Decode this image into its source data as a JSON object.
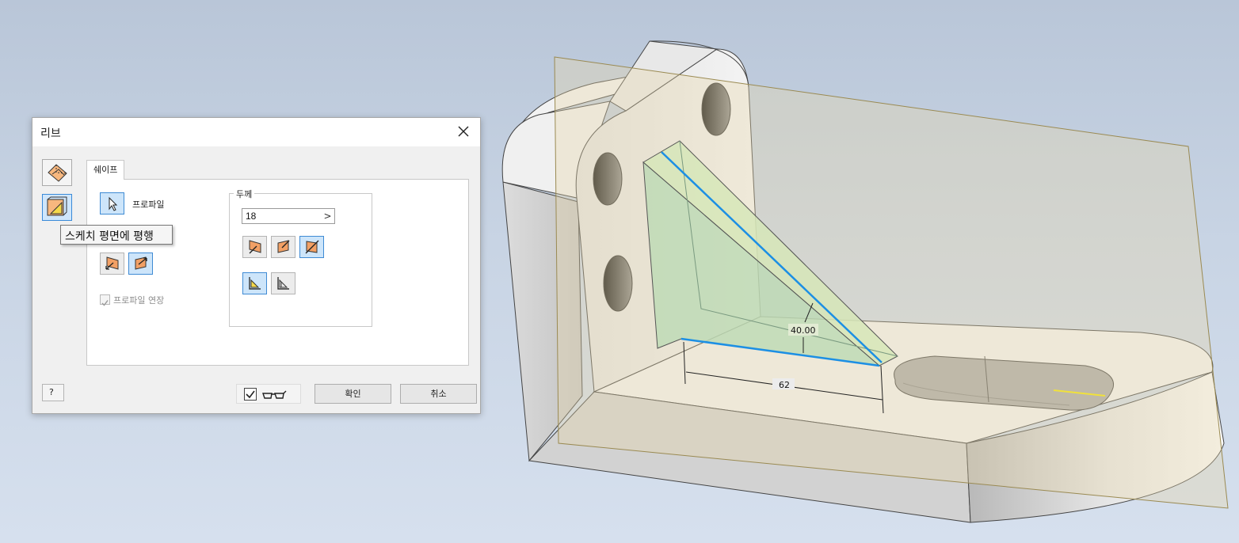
{
  "dialog": {
    "title": "리브",
    "tab_label": "쉐이프",
    "profile_label": "프로파일",
    "extend_profile_label": "프로파일 연장",
    "thickness_group_label": "두께",
    "thickness_value": "18",
    "spin_glyph": ">",
    "tooltip": "스케치 평면에 평행",
    "ok_label": "확인",
    "cancel_label": "취소",
    "help_glyph": "?"
  },
  "model": {
    "dimension_angle": "40.00",
    "dimension_length": "62"
  },
  "colors": {
    "selection_blue": "#1c8fe4",
    "rib_green": "#bcd9b4",
    "work_plane": "#e8d7a8",
    "accent_orange": "#f2a065"
  }
}
